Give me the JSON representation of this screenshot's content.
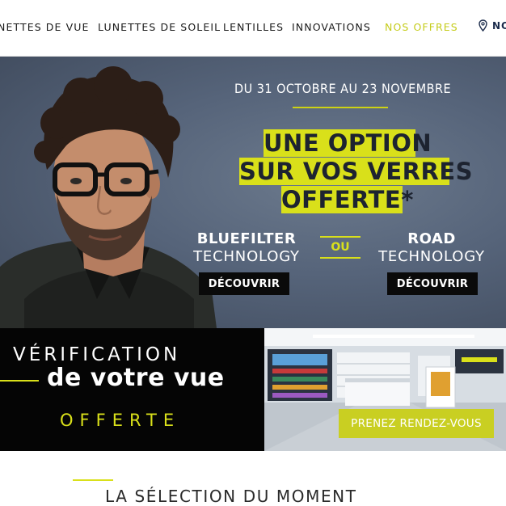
{
  "nav": {
    "items": [
      {
        "label": "NETTES DE VUE"
      },
      {
        "label": "LUNETTES DE SOLEIL"
      },
      {
        "label": "LENTILLES"
      },
      {
        "label": "INNOVATIONS"
      },
      {
        "label": "NOS OFFRES"
      }
    ],
    "location_label": "NO",
    "location_icon": "map-pin-icon",
    "offers_color": "#c5cc1b"
  },
  "hero": {
    "date_range": "DU 31 OCTOBRE AU 23 NOVEMBRE",
    "headline_lines": [
      "UNE OPTION",
      "SUR VOS VERRES",
      "OFFERTE*"
    ],
    "technologies": [
      {
        "name": "BLUEFILTER",
        "subtitle": "TECHNOLOGY",
        "cta": "DÉCOUVRIR"
      },
      {
        "name": "ROAD",
        "subtitle": "TECHNOLOGY",
        "cta": "DÉCOUVRIR"
      }
    ],
    "separator": "OU",
    "accent_color": "#d9e01a"
  },
  "banner": {
    "line1": "VÉRIFICATION",
    "line2": "de votre vue",
    "line3": "OFFERTE",
    "cta": "PRENEZ RENDEZ-VOUS"
  },
  "section": {
    "title": "LA SÉLECTION DU MOMENT"
  }
}
